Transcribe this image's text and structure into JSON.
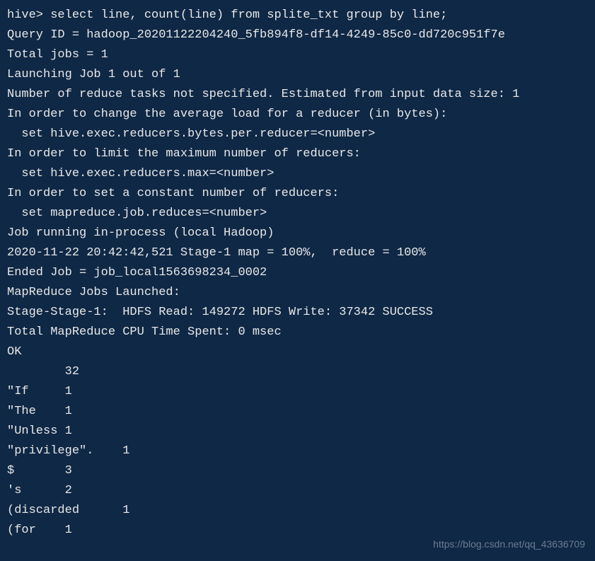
{
  "terminal": {
    "prompt": "hive> ",
    "command": "select line, count(line) from splite_txt group by line;",
    "output_lines": [
      "Query ID = hadoop_20201122204240_5fb894f8-df14-4249-85c0-dd720c951f7e",
      "Total jobs = 1",
      "Launching Job 1 out of 1",
      "Number of reduce tasks not specified. Estimated from input data size: 1",
      "In order to change the average load for a reducer (in bytes):",
      "  set hive.exec.reducers.bytes.per.reducer=<number>",
      "In order to limit the maximum number of reducers:",
      "  set hive.exec.reducers.max=<number>",
      "In order to set a constant number of reducers:",
      "  set mapreduce.job.reduces=<number>",
      "Job running in-process (local Hadoop)",
      "2020-11-22 20:42:42,521 Stage-1 map = 100%,  reduce = 100%",
      "Ended Job = job_local1563698234_0002",
      "MapReduce Jobs Launched:",
      "Stage-Stage-1:  HDFS Read: 149272 HDFS Write: 37342 SUCCESS",
      "Total MapReduce CPU Time Spent: 0 msec",
      "OK"
    ],
    "result_rows": [
      {
        "word": "",
        "count": "32"
      },
      {
        "word": "\"If",
        "count": "1"
      },
      {
        "word": "\"The",
        "count": "1"
      },
      {
        "word": "\"Unless",
        "count": "1"
      },
      {
        "word": "\"privilege\".",
        "count": "1"
      },
      {
        "word": "$",
        "count": "3"
      },
      {
        "word": "'s",
        "count": "2"
      },
      {
        "word": "(discarded",
        "count": "1"
      },
      {
        "word": "(for",
        "count": "1"
      }
    ]
  },
  "watermark": "https://blog.csdn.net/qq_43636709"
}
